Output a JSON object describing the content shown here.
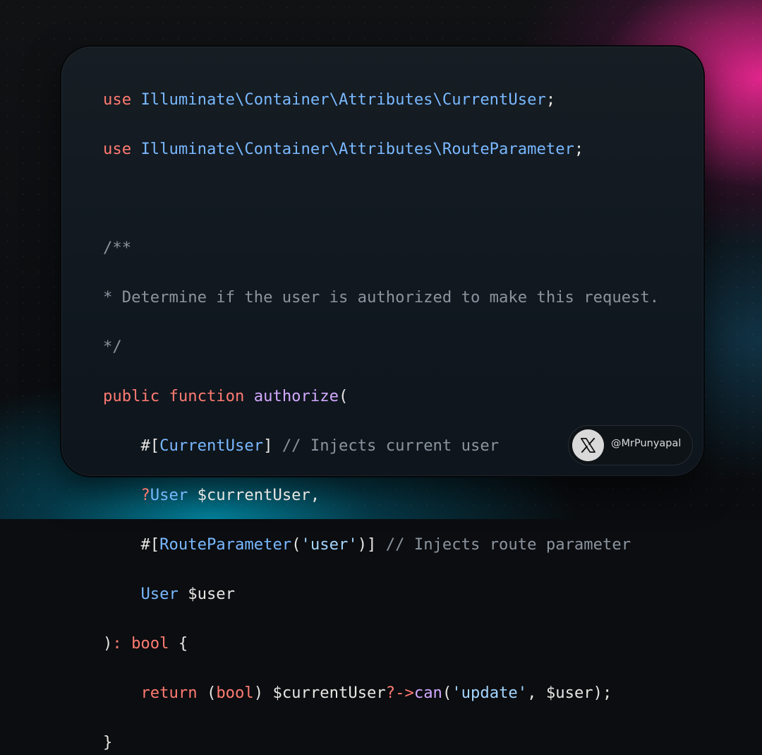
{
  "code": {
    "line1": {
      "kw": "use",
      "ns": "Illuminate\\Container\\Attributes\\CurrentUser",
      "end": ";"
    },
    "line2": {
      "kw": "use",
      "ns": "Illuminate\\Container\\Attributes\\RouteParameter",
      "end": ";"
    },
    "doc_open": "/**",
    "doc_text": "* Determine if the user is authorized to make this request.",
    "doc_close": "*/",
    "sig": {
      "public": "public",
      "function": "function",
      "name": "authorize",
      "paren": "("
    },
    "p1": {
      "attr_open": "#[",
      "attr_name": "CurrentUser",
      "attr_close": "]",
      "comment": "// Injects current user"
    },
    "p2": {
      "nullable": "?",
      "type": "User",
      "var": "$currentUser,"
    },
    "p3": {
      "attr_open": "#[",
      "attr_name": "RouteParameter",
      "arg_open": "(",
      "arg": "'user'",
      "arg_close": ")]",
      "comment": "// Injects route parameter"
    },
    "p4": {
      "type": "User",
      "var": "$user"
    },
    "ret": {
      "close": ")",
      "colon": ":",
      "type": "bool",
      "brace": "{"
    },
    "body": {
      "return": "return",
      "cast_open": "(",
      "cast": "bool",
      "cast_close": ")",
      "var": "$currentUser",
      "arrow": "?->",
      "method": "can",
      "open": "(",
      "arg1": "'update'",
      "comma": ", $user);"
    },
    "end": "}"
  },
  "badge": {
    "icon": "x-logo-icon",
    "handle": "@MrPunyapal"
  }
}
